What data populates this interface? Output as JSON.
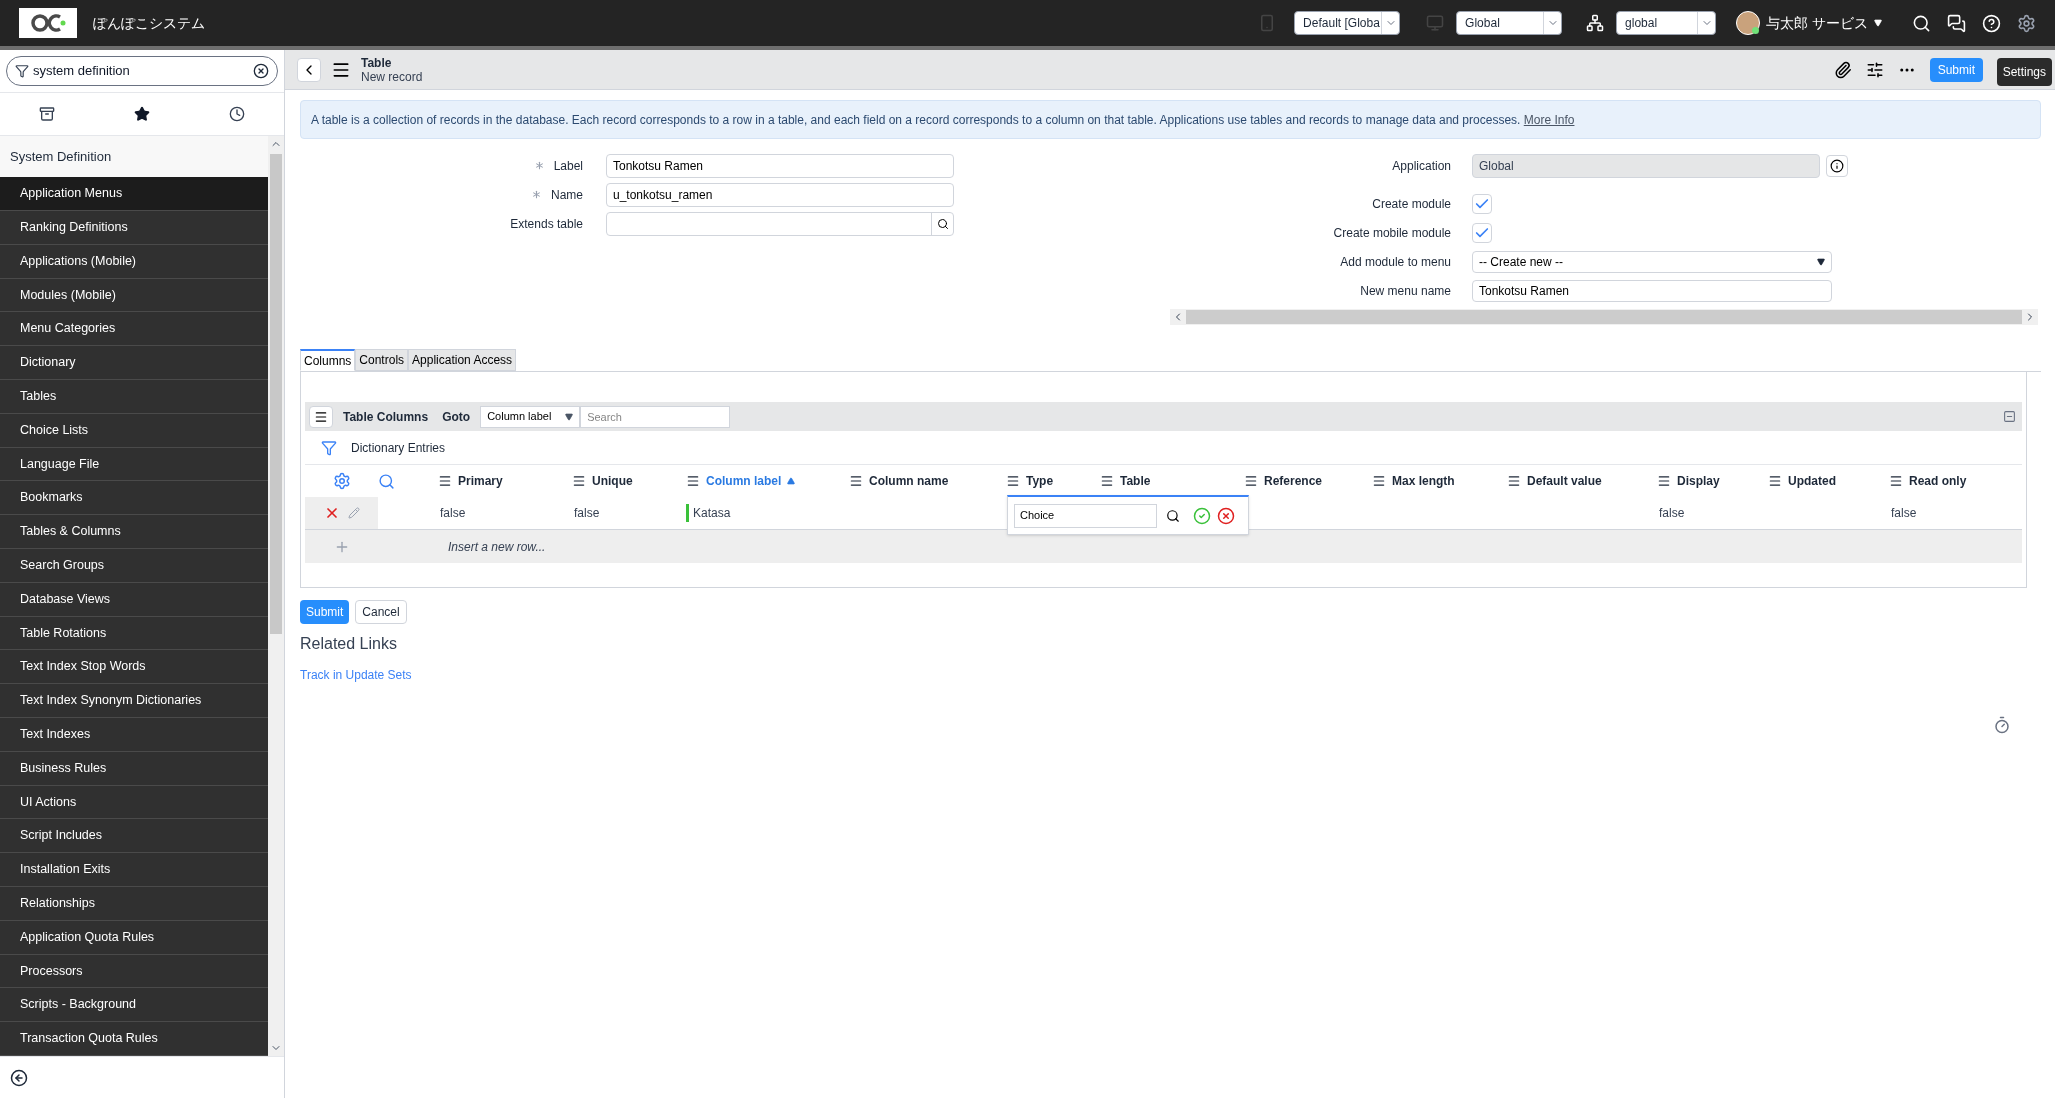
{
  "header": {
    "app_name": "ぽんぽこシステム",
    "update_set": "Default [Globa",
    "scope": "Global",
    "domain": "global",
    "user": "与太郎 サービス",
    "tooltip": "Settings"
  },
  "nav": {
    "filter": "system definition",
    "section": "System Definition",
    "items": [
      {
        "label": "Application Menus",
        "selected": true
      },
      {
        "label": "Ranking Definitions",
        "selected": false
      },
      {
        "label": "Applications (Mobile)",
        "selected": false
      },
      {
        "label": "Modules (Mobile)",
        "selected": false
      },
      {
        "label": "Menu Categories",
        "selected": false
      },
      {
        "label": "Dictionary",
        "selected": false
      },
      {
        "label": "Tables",
        "selected": false
      },
      {
        "label": "Choice Lists",
        "selected": false
      },
      {
        "label": "Language File",
        "selected": false
      },
      {
        "label": "Bookmarks",
        "selected": false
      },
      {
        "label": "Tables & Columns",
        "selected": false
      },
      {
        "label": "Search Groups",
        "selected": false
      },
      {
        "label": "Database Views",
        "selected": false
      },
      {
        "label": "Table Rotations",
        "selected": false
      },
      {
        "label": "Text Index Stop Words",
        "selected": false
      },
      {
        "label": "Text Index Synonym Dictionaries",
        "selected": false
      },
      {
        "label": "Text Indexes",
        "selected": false
      },
      {
        "label": "Business Rules",
        "selected": false
      },
      {
        "label": "UI Actions",
        "selected": false
      },
      {
        "label": "Script Includes",
        "selected": false
      },
      {
        "label": "Installation Exits",
        "selected": false
      },
      {
        "label": "Relationships",
        "selected": false
      },
      {
        "label": "Application Quota Rules",
        "selected": false
      },
      {
        "label": "Processors",
        "selected": false
      },
      {
        "label": "Scripts - Background",
        "selected": false
      },
      {
        "label": "Transaction Quota Rules",
        "selected": false
      }
    ]
  },
  "form_header": {
    "title": "Table",
    "subtitle": "New record",
    "submit": "Submit"
  },
  "info": {
    "text": "A table is a collection of records in the database. Each record corresponds to a row in a table, and each field on a record corresponds to a column on that table. Applications use tables and records to manage data and processes.",
    "link": "More Info"
  },
  "left_fields": [
    {
      "kind": "text",
      "label": "Label",
      "value": "Tonkotsu Ramen",
      "required": true
    },
    {
      "kind": "text",
      "label": "Name",
      "value": "u_tonkotsu_ramen",
      "required": true
    },
    {
      "kind": "reference",
      "label": "Extends table",
      "required": false
    }
  ],
  "right_fields": [
    {
      "kind": "readonly",
      "label": "Application",
      "value": "Global"
    },
    {
      "kind": "checkbox",
      "label": "Create module",
      "checked": true
    },
    {
      "kind": "checkbox",
      "label": "Create mobile module",
      "checked": true
    },
    {
      "kind": "select",
      "label": "Add module to menu",
      "value": "-- Create new --"
    },
    {
      "kind": "text",
      "label": "New menu name",
      "value": "Tonkotsu Ramen"
    }
  ],
  "tabs": [
    {
      "label": "Columns",
      "selected": true
    },
    {
      "label": "Controls",
      "selected": false
    },
    {
      "label": "Application Access",
      "selected": false
    }
  ],
  "related_list": {
    "title": "Table Columns",
    "goto": "Goto",
    "goto_field": "Column label",
    "search_placeholder": "Search",
    "filter": "Dictionary Entries",
    "columns": [
      {
        "label": "Primary",
        "sorted": false
      },
      {
        "label": "Unique",
        "sorted": false
      },
      {
        "label": "Column label",
        "sorted": true
      },
      {
        "label": "Column name",
        "sorted": false
      },
      {
        "label": "Type",
        "sorted": false
      },
      {
        "label": "Table",
        "sorted": false
      },
      {
        "label": "Reference",
        "sorted": false
      },
      {
        "label": "Max length",
        "sorted": false
      },
      {
        "label": "Default value",
        "sorted": false
      },
      {
        "label": "Display",
        "sorted": false
      },
      {
        "label": "Updated",
        "sorted": false
      },
      {
        "label": "Read only",
        "sorted": false
      }
    ],
    "rows": [
      {
        "cells": [
          {
            "kind": "value",
            "text": "false",
            "changed": false
          },
          {
            "kind": "value",
            "text": "false",
            "changed": false
          },
          {
            "kind": "value",
            "text": "Katasa",
            "changed": true
          },
          {
            "kind": "empty"
          },
          {
            "kind": "empty"
          },
          {
            "kind": "empty"
          },
          {
            "kind": "empty"
          },
          {
            "kind": "empty"
          },
          {
            "kind": "empty"
          },
          {
            "kind": "value",
            "text": "false",
            "changed": false
          },
          {
            "kind": "empty"
          },
          {
            "kind": "value",
            "text": "false",
            "changed": false
          }
        ]
      }
    ],
    "insert_row": "Insert a new row...",
    "editor": {
      "value": "Choice"
    }
  },
  "form_buttons": [
    {
      "kind": "primary",
      "label": "Submit"
    },
    {
      "kind": "default",
      "label": "Cancel"
    }
  ],
  "related_links": {
    "title": "Related Links",
    "links": [
      "Track in Update Sets"
    ]
  }
}
